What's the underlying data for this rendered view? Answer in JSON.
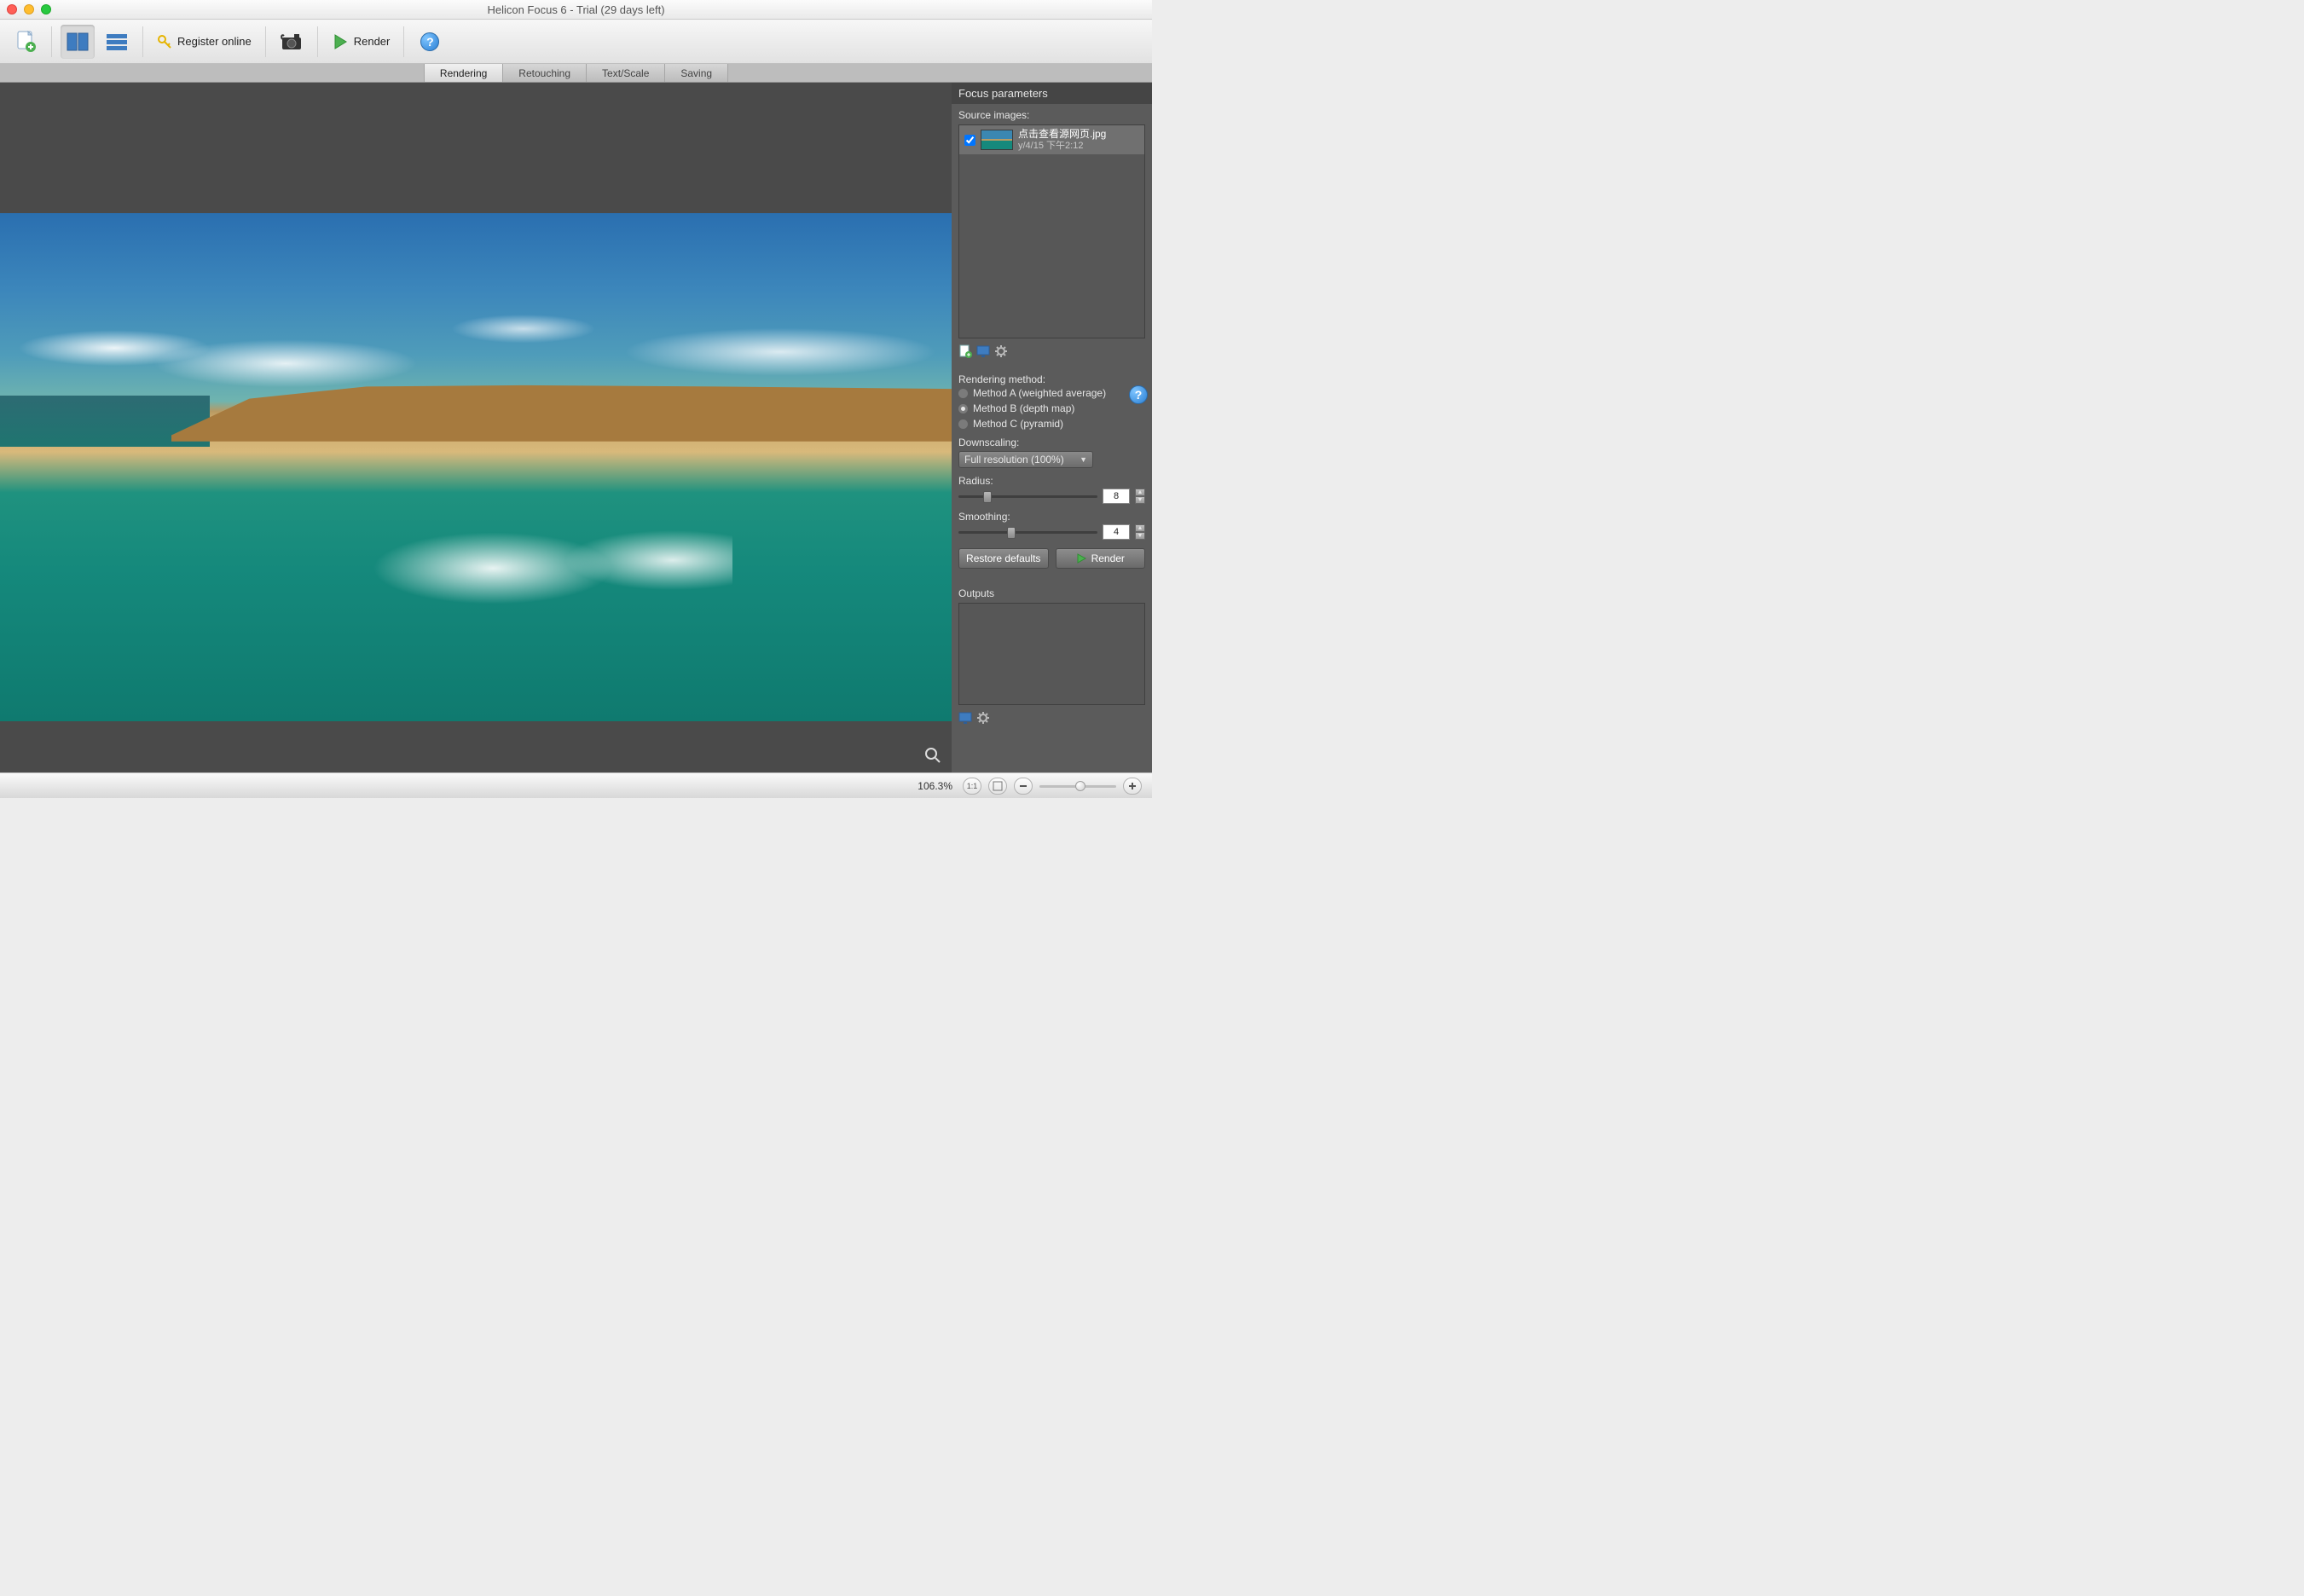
{
  "window": {
    "title": "Helicon Focus 6 - Trial (29 days left)"
  },
  "toolbar": {
    "register_label": "Register online",
    "render_label": "Render"
  },
  "tabs": {
    "rendering": "Rendering",
    "retouching": "Retouching",
    "textscale": "Text/Scale",
    "saving": "Saving"
  },
  "panel": {
    "title": "Focus parameters",
    "source_images_label": "Source images:",
    "source": {
      "filename": "点击查看源网页.jpg",
      "datetime": "y/4/15 下午2:12"
    },
    "rendering_method_label": "Rendering method:",
    "methods": {
      "a": "Method A (weighted average)",
      "b": "Method B (depth map)",
      "c": "Method C (pyramid)"
    },
    "downscaling_label": "Downscaling:",
    "downscaling_value": "Full resolution (100%)",
    "radius_label": "Radius:",
    "radius_value": "8",
    "smoothing_label": "Smoothing:",
    "smoothing_value": "4",
    "restore_label": "Restore defaults",
    "render_label": "Render",
    "outputs_label": "Outputs"
  },
  "status": {
    "zoom": "106.3%",
    "fit_label": "1:1"
  }
}
